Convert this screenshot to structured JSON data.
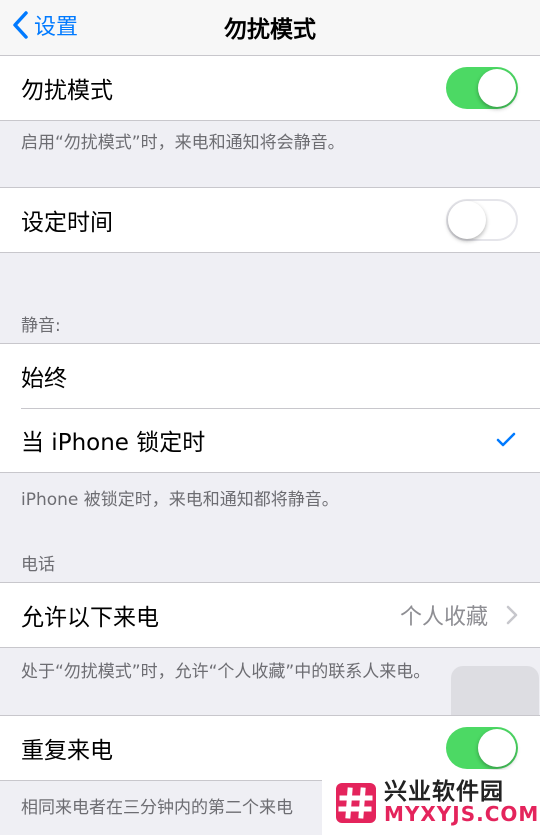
{
  "nav": {
    "back_label": "设置",
    "title": "勿扰模式"
  },
  "dnd": {
    "label": "勿扰模式",
    "on": true,
    "footer": "启用“勿扰模式”时，来电和通知将会静音。"
  },
  "schedule": {
    "label": "设定时间",
    "on": false
  },
  "silence": {
    "header": "静音:",
    "options": [
      {
        "label": "始终",
        "selected": false
      },
      {
        "label": "当 iPhone 锁定时",
        "selected": true
      }
    ],
    "footer": "iPhone 被锁定时，来电和通知都将静音。"
  },
  "phone": {
    "header": "电话",
    "allow_calls_label": "允许以下来电",
    "allow_calls_value": "个人收藏",
    "footer": "处于“勿扰模式”时，允许“个人收藏”中的联系人来电。"
  },
  "repeat": {
    "label": "重复来电",
    "on": true,
    "footer": "相同来电者在三分钟内的第二个来电"
  },
  "watermark": {
    "cn": "兴业软件园",
    "en": "MYXYJS.COM"
  },
  "colors": {
    "accent": "#007aff",
    "toggle_on": "#4cd964",
    "watermark_red": "#e4245c"
  }
}
